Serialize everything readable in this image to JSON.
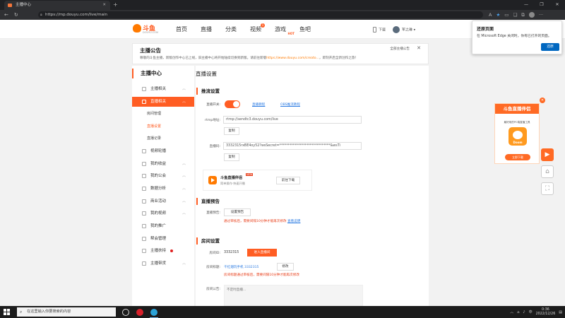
{
  "browser": {
    "tab_title": "主播中心",
    "tab_close": "✕",
    "new_tab": "+",
    "url": "https://mp.douyu.com/live/main",
    "window_controls": [
      "—",
      "❐",
      "✕"
    ],
    "icons": [
      "read-aloud-icon",
      "star-icon",
      "collections-icon",
      "extensions-icon",
      "profile-avatar",
      "more-icon"
    ]
  },
  "site_header": {
    "logo_text": "斗鱼",
    "logo_sub": "DOUYU.COM",
    "nav": [
      {
        "label": "首页"
      },
      {
        "label": "直播"
      },
      {
        "label": "分类"
      },
      {
        "label": "视频",
        "badge": "1"
      },
      {
        "label": "游戏",
        "tag": "HOT"
      },
      {
        "label": "鱼吧"
      }
    ],
    "download": "下载",
    "username": "军之琳"
  },
  "announcement": {
    "title": "主播公告",
    "text": "尊敬的斗鱼主播，新版创作中心已上线，旧主播中心将开始陆续切换到新版。请前往新版",
    "link": "https://www.douyu.com/creato...",
    "text_after": "，即刻开启全新创作之旅！",
    "all_posts": "全部主播公告",
    "close": "✕"
  },
  "sidebar": {
    "title": "主播中心",
    "items": [
      {
        "label": "主播相关",
        "chevron": "︿"
      },
      {
        "label": "直播相关",
        "chevron": "︿",
        "active": true
      },
      {
        "label": "视频轮播"
      },
      {
        "label": "我的收益",
        "chevron": "︿"
      },
      {
        "label": "我的公会",
        "chevron": "︿"
      },
      {
        "label": "数据分析",
        "chevron": "︿"
      },
      {
        "label": "商业活动",
        "chevron": "︿"
      },
      {
        "label": "我的视频",
        "chevron": "︿"
      },
      {
        "label": "我的推广"
      },
      {
        "label": "帮会管理"
      },
      {
        "label": "主播扶持"
      },
      {
        "label": "主播带货",
        "chevron": "︿"
      }
    ],
    "subitems": [
      "房间管理",
      "直播设置",
      "直播记录"
    ]
  },
  "main": {
    "title": "直播设置",
    "stream_section": "推流设置",
    "live_switch_label": "直播开关:",
    "live_tutorial": "直播教程",
    "obs_tutorial": "OBS推流教程",
    "rtmp_label": "rtmp地址:",
    "rtmp_value": "rtmp://sendtc3.douyu.com/live",
    "copy": "复制",
    "code_label": "直播码:",
    "code_value": "3332315rxBE4oy52?wsSecret=******************************&wsTi",
    "promo": {
      "name": "斗鱼直播伴侣",
      "new": "NEW",
      "desc": "简单操作·快速开播",
      "button": "前往下载"
    },
    "preview_section": "直播预告",
    "preview_label": "直播预告:",
    "set_preview": "设置预告",
    "preview_warn": "通过审核后，需要间隔10分钟才能再次修改",
    "view_notes": "查看说明",
    "room_section": "房间设置",
    "room_id_label": "房间ID:",
    "room_id": "3332315",
    "enter_room": "进入直播间",
    "room_title_label": "房间标题:",
    "room_title": "千红烟玩手机 3332315",
    "modify": "修改",
    "room_title_warn": "房间标题通过审核后，需要间隔10分钟才能再次修改",
    "room_notice_label": "房间公告:",
    "room_notice_placeholder": "不定时直播..."
  },
  "widget": {
    "title": "斗鱼直播伴侣",
    "desc": "最好用的PC端直播工具",
    "logo_text": "Doom",
    "button": "立即下载",
    "close": "✕"
  },
  "toast": {
    "title": "还原页面",
    "message": "在 Microsoft Edge 关闭时，你有已打开的页面。",
    "button": "还原"
  },
  "taskbar": {
    "search_placeholder": "在这里输入你要搜索的内容",
    "time": "0:36",
    "date": "2022/12/26",
    "lang": "中"
  },
  "colors": {
    "accent": "#ff5d23",
    "link": "#2a7ae2",
    "warn": "#e8401c",
    "edge_blue": "#0067c0"
  }
}
